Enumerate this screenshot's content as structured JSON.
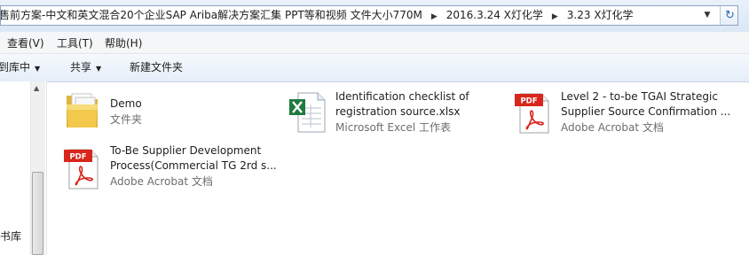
{
  "address": {
    "crumbs": [
      "售前方案-中文和英文混合20个企业SAP Ariba解决方案汇集 PPT等和视频 文件大小770M",
      "2016.3.24 X灯化学",
      "3.23 X灯化学"
    ]
  },
  "menu": {
    "view": "查看(V)",
    "tools": "工具(T)",
    "help": "帮助(H)"
  },
  "toolbar": {
    "include_library": "到库中",
    "share": "共享",
    "new_folder": "新建文件夹"
  },
  "nav": {
    "library_label": "书库"
  },
  "files": [
    {
      "name1": "Demo",
      "name2": "",
      "type": "文件夹",
      "icon": "folder-icon"
    },
    {
      "name1": "Identification checklist of",
      "name2": "registration source.xlsx",
      "type": "Microsoft Excel 工作表",
      "icon": "excel-icon"
    },
    {
      "name1": "Level 2 -  to-be TGAI Strategic",
      "name2": "Supplier Source Confirmation ...",
      "type": "Adobe Acrobat 文档",
      "icon": "pdf-icon"
    },
    {
      "name1": "To-Be Supplier Development",
      "name2": "Process(Commercial TG 2rd s...",
      "type": "Adobe Acrobat 文档",
      "icon": "pdf-icon"
    }
  ],
  "icon_labels": {
    "pdf": "PDF"
  },
  "colors": {
    "pdf_red": "#d8261c",
    "excel_green": "#1f7a3f",
    "folder_yellow": "#f2c94c"
  }
}
